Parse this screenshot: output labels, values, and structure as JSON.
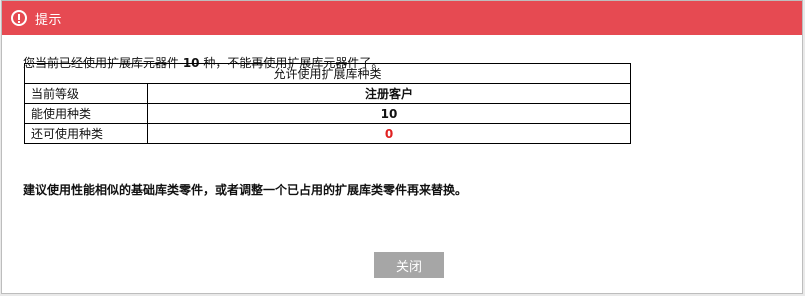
{
  "dialog": {
    "title": "提示",
    "icon": "alert-circle-icon",
    "title_bar_color": "#e64a52",
    "message": {
      "prefix": "您当前已经使用扩展库元器件 ",
      "count": "10",
      "suffix": " 种，不能再使用扩展库元器件了。"
    },
    "table": {
      "header": "允许使用扩展库种类",
      "rows": [
        {
          "label": "当前等级",
          "value": "注册客户"
        },
        {
          "label": "能使用种类",
          "value": "10"
        },
        {
          "label": "还可使用种类",
          "value": "0",
          "value_color": "#e02020"
        }
      ]
    },
    "advice": "建议使用性能相似的基础库类零件，或者调整一个已占用的扩展库类零件再来替换。",
    "close_button": {
      "label": "关闭",
      "color": "#a6a6a6"
    }
  }
}
